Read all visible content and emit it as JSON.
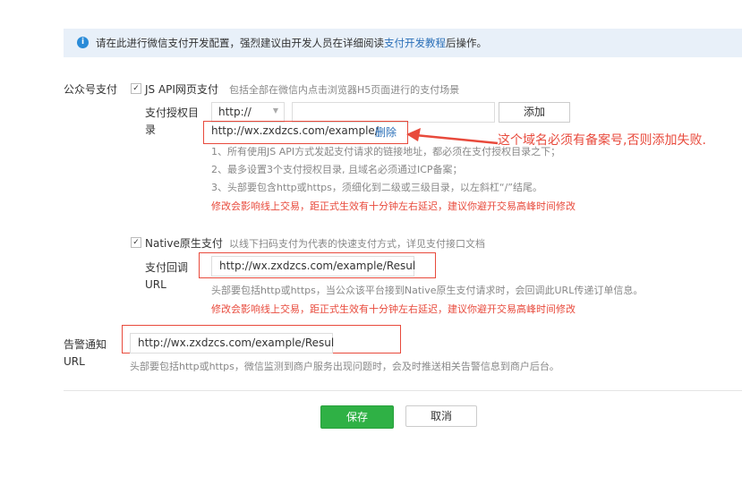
{
  "notice": {
    "icon": "info-icon",
    "text_before": "请在此进行微信支付开发配置，强烈建议由开发人员在详细阅读",
    "link": "支付开发教程",
    "text_after": "后操作。"
  },
  "public_account": {
    "label": "公众号支付",
    "jsapi": {
      "checked": true,
      "title": "JS API网页支付",
      "description": "包括全部在微信内点击浏览器H5页面进行的支付场景",
      "dir_label_1": "支付授权目",
      "dir_label_2": "录",
      "protocol_select": "http://",
      "add_button": "添加",
      "entry_url": "http://wx.zxdzcs.com/example/",
      "delete_link": "删除",
      "annotation": "这个域名必须有备案号,否则添加失败.",
      "hints": [
        "1、所有使用JS API方式发起支付请求的链接地址，都必须在支付授权目录之下；",
        "2、最多设置3个支付授权目录, 且域名必须通过ICP备案；",
        "3、头部要包含http或https，须细化到二级或三级目录，以左斜杠“/”结尾。"
      ],
      "warning": "修改会影响线上交易，距正式生效有十分钟左右延迟，建议你避开交易高峰时间修改"
    },
    "native": {
      "checked": true,
      "title": "Native原生支付",
      "description": "以线下扫码支付为代表的快速支付方式，详见支付接口文档",
      "callback_label_1": "支付回调",
      "callback_label_2": "URL",
      "callback_url": "http://wx.zxdzcs.com/example/Resul",
      "hint": "头部要包括http或https，当公众该平台接到Native原生支付请求时，会回调此URL传递订单信息。",
      "warning": "修改会影响线上交易，距正式生效有十分钟左右延迟，建议你避开交易高峰时间修改"
    }
  },
  "alert": {
    "label_1": "告警通知",
    "label_2": "URL",
    "url": "http://wx.zxdzcs.com/example/Resul",
    "hint": "头部要包括http或https，微信监测到商户服务出现问题时，会及时推送相关告警信息到商户后台。"
  },
  "actions": {
    "save": "保存",
    "cancel": "取消"
  },
  "colors": {
    "accent_green": "#2fb145",
    "warning_red": "#e84a3c",
    "link_blue": "#2a6fb8",
    "notice_bg": "#e8f0f9"
  }
}
